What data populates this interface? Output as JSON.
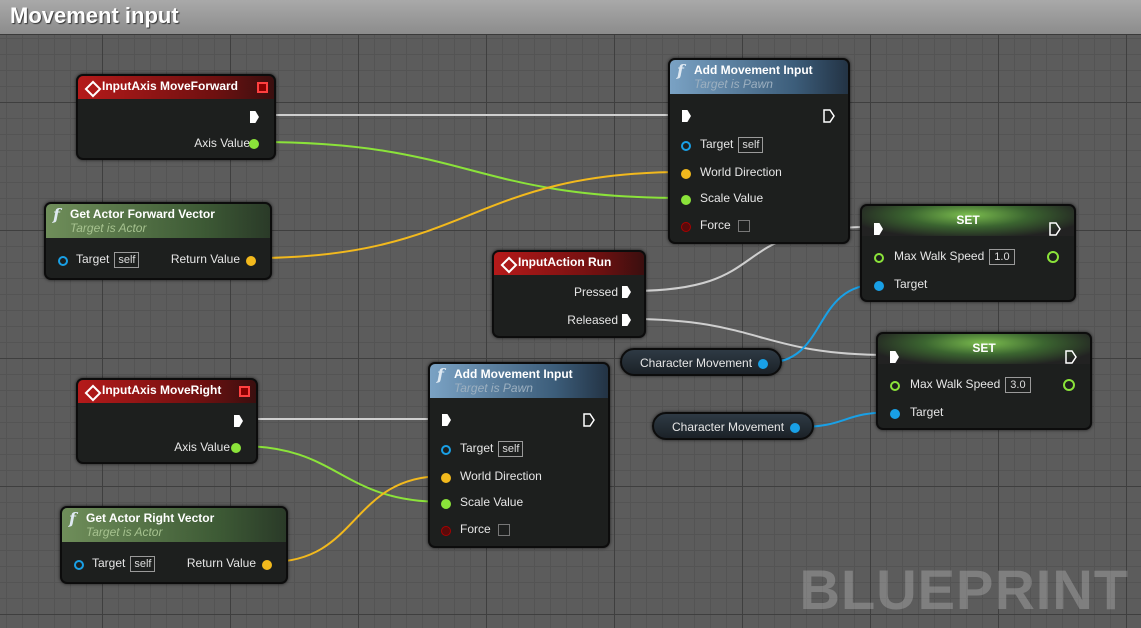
{
  "graph_title": "Movement input",
  "watermark": "BLUEPRINT",
  "nodes": {
    "axis_forward": {
      "title": "InputAxis MoveForward",
      "axis_label": "Axis Value"
    },
    "get_forward": {
      "title": "Get Actor Forward Vector",
      "subtitle": "Target is Actor",
      "target_label": "Target",
      "target_value": "self",
      "return_label": "Return Value"
    },
    "add_move_1": {
      "title": "Add Movement Input",
      "subtitle": "Target is Pawn",
      "target_label": "Target",
      "target_value": "self",
      "world_dir_label": "World Direction",
      "scale_label": "Scale Value",
      "force_label": "Force"
    },
    "action_run": {
      "title": "InputAction Run",
      "pressed_label": "Pressed",
      "released_label": "Released"
    },
    "set_1": {
      "title": "SET",
      "speed_label": "Max Walk Speed",
      "speed_value": "1.0",
      "target_label": "Target"
    },
    "set_2": {
      "title": "SET",
      "speed_label": "Max Walk Speed",
      "speed_value": "3.0",
      "target_label": "Target"
    },
    "char_move_1": {
      "label": "Character Movement"
    },
    "char_move_2": {
      "label": "Character Movement"
    },
    "axis_right": {
      "title": "InputAxis MoveRight",
      "axis_label": "Axis Value"
    },
    "get_right": {
      "title": "Get Actor Right Vector",
      "subtitle": "Target is Actor",
      "target_label": "Target",
      "target_value": "self",
      "return_label": "Return Value"
    },
    "add_move_2": {
      "title": "Add Movement Input",
      "subtitle": "Target is Pawn",
      "target_label": "Target",
      "target_value": "self",
      "world_dir_label": "World Direction",
      "scale_label": "Scale Value",
      "force_label": "Force"
    }
  },
  "colors": {
    "exec": "#ffffff",
    "float": "#8be33a",
    "vector": "#f2b91d",
    "object": "#19a0e6",
    "bool": "#a00000"
  }
}
